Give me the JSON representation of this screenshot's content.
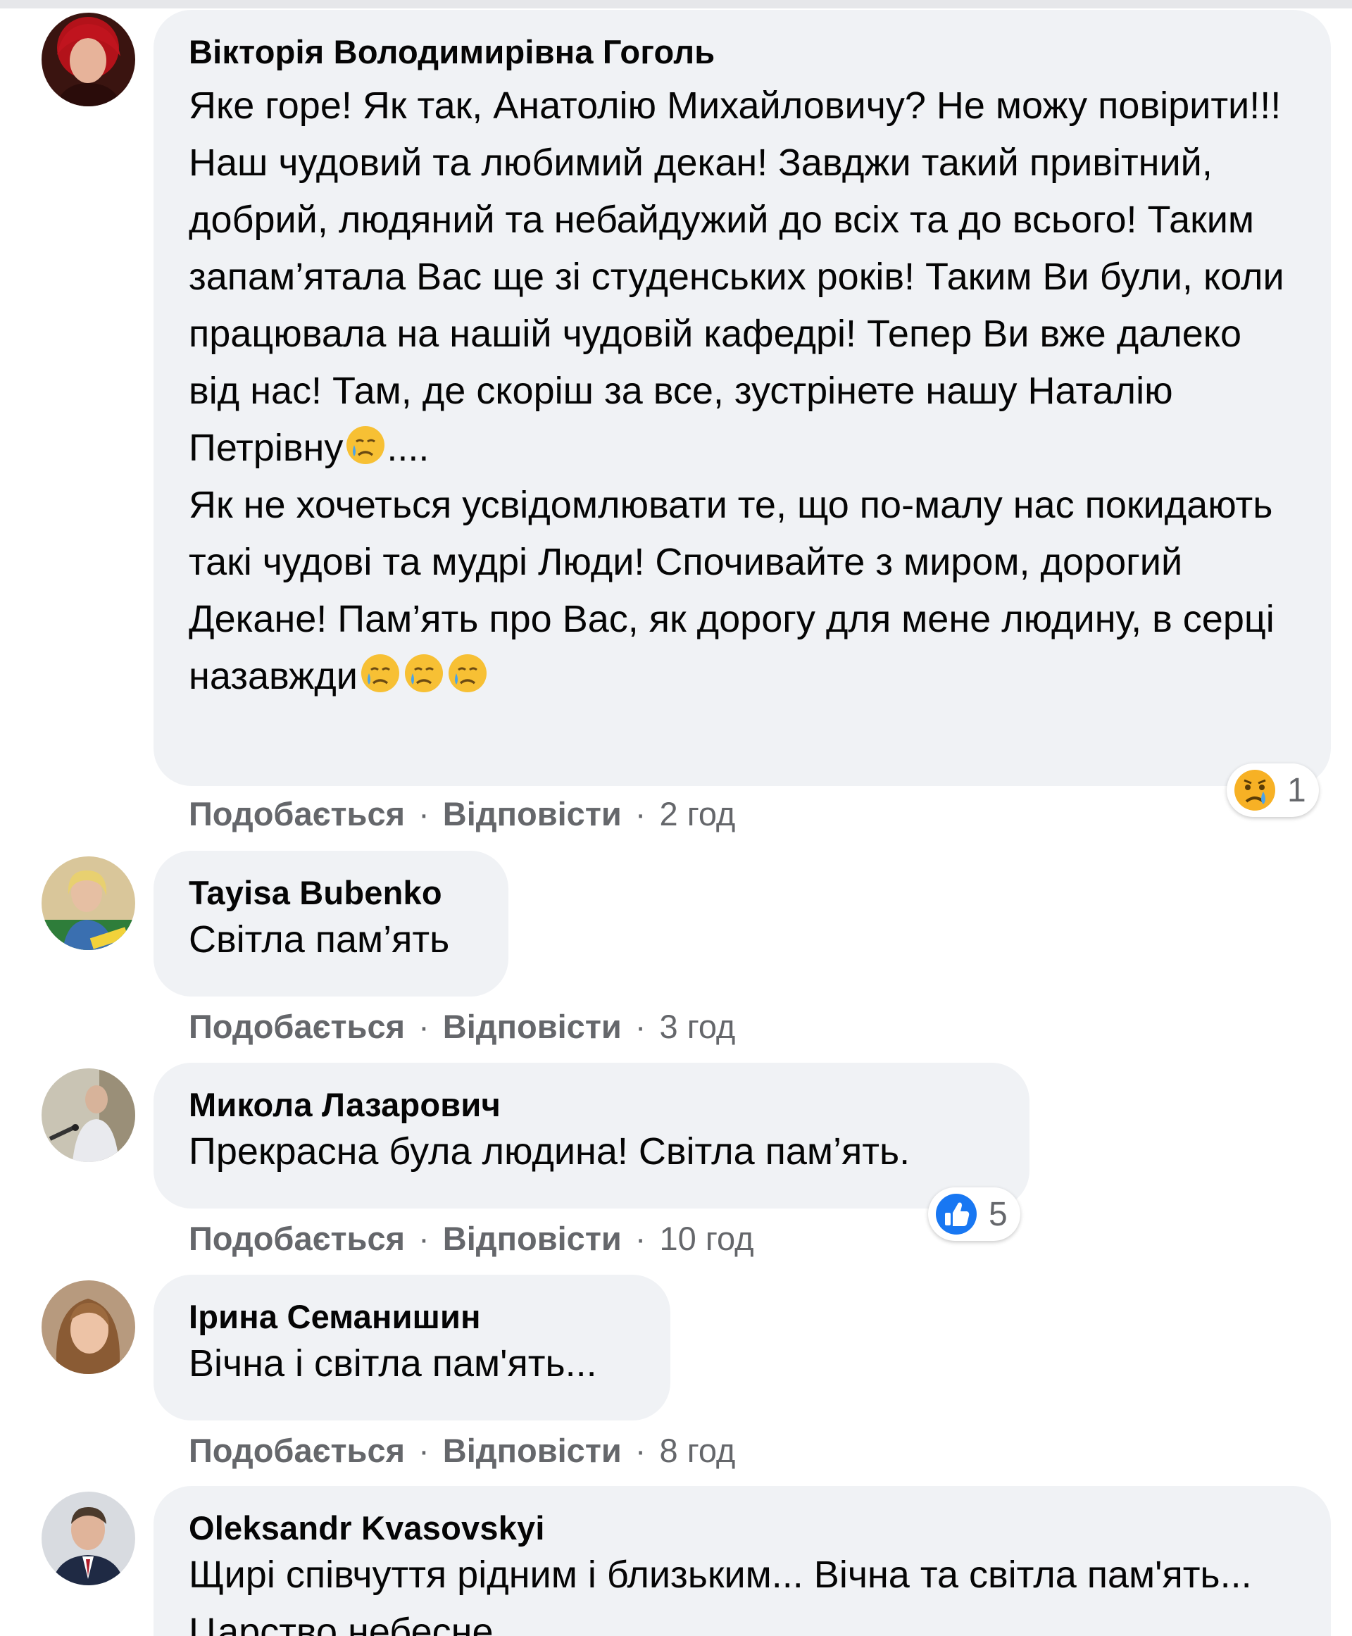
{
  "comments": [
    {
      "author": "Вікторія Володимирівна Гоголь",
      "paragraphs": [
        "Яке горе! Як так, Анатолію Михайловичу? Не можу повірити!!! Наш чудовий та любимий декан! Завджи такий привітний, добрий, людяний та небайдужий до всіх та до всього! Таким запам’ятала Вас ще зі студенських років! Таким Ви були, коли працювала на нашій чудовій кафедрі! Тепер Ви вже далеко від нас! Там, де скоріш за все, зустрінете нашу Наталію Петрівну",
        "....",
        "Як не хочеться усвідомлювати те, що по-малу нас покидають такі чудові та мудрі Люди! Спочивайте з миром, дорогий Декане! Пам’ять про Вас, як дорогу для мене людину, в серці назавжди"
      ],
      "emoji": "crying-face",
      "like_label": "Подобається",
      "reply_label": "Відповісти",
      "separator": "·",
      "time": "2 год",
      "reaction": {
        "type": "sad",
        "count": "1"
      }
    },
    {
      "author": "Tayisa Bubenko",
      "text": "Світла пам’ять",
      "like_label": "Подобається",
      "reply_label": "Відповісти",
      "separator": "·",
      "time": "3 год"
    },
    {
      "author": "Микола Лазарович",
      "text": "Прекрасна була людина! Світла пам’ять.",
      "like_label": "Подобається",
      "reply_label": "Відповісти",
      "separator": "·",
      "time": "10 год",
      "reaction": {
        "type": "like",
        "count": "5"
      }
    },
    {
      "author": "Ірина Семанишин",
      "text": "Вічна і світла пам'ять...",
      "like_label": "Подобається",
      "reply_label": "Відповісти",
      "separator": "·",
      "time": "8 год"
    },
    {
      "author": "Oleksandr Kvasovskyi",
      "text": "Щирі співчуття рідним і близьким... Вічна та світла пам'ять... Царство небесне...",
      "like_label": "",
      "reply_label": "",
      "separator": "",
      "time": ""
    }
  ],
  "colors": {
    "bubble": "#f0f2f5",
    "text": "#050505",
    "secondary": "#65676b",
    "like_blue": "#1877f2",
    "sad_yellow": "#f7b125"
  }
}
